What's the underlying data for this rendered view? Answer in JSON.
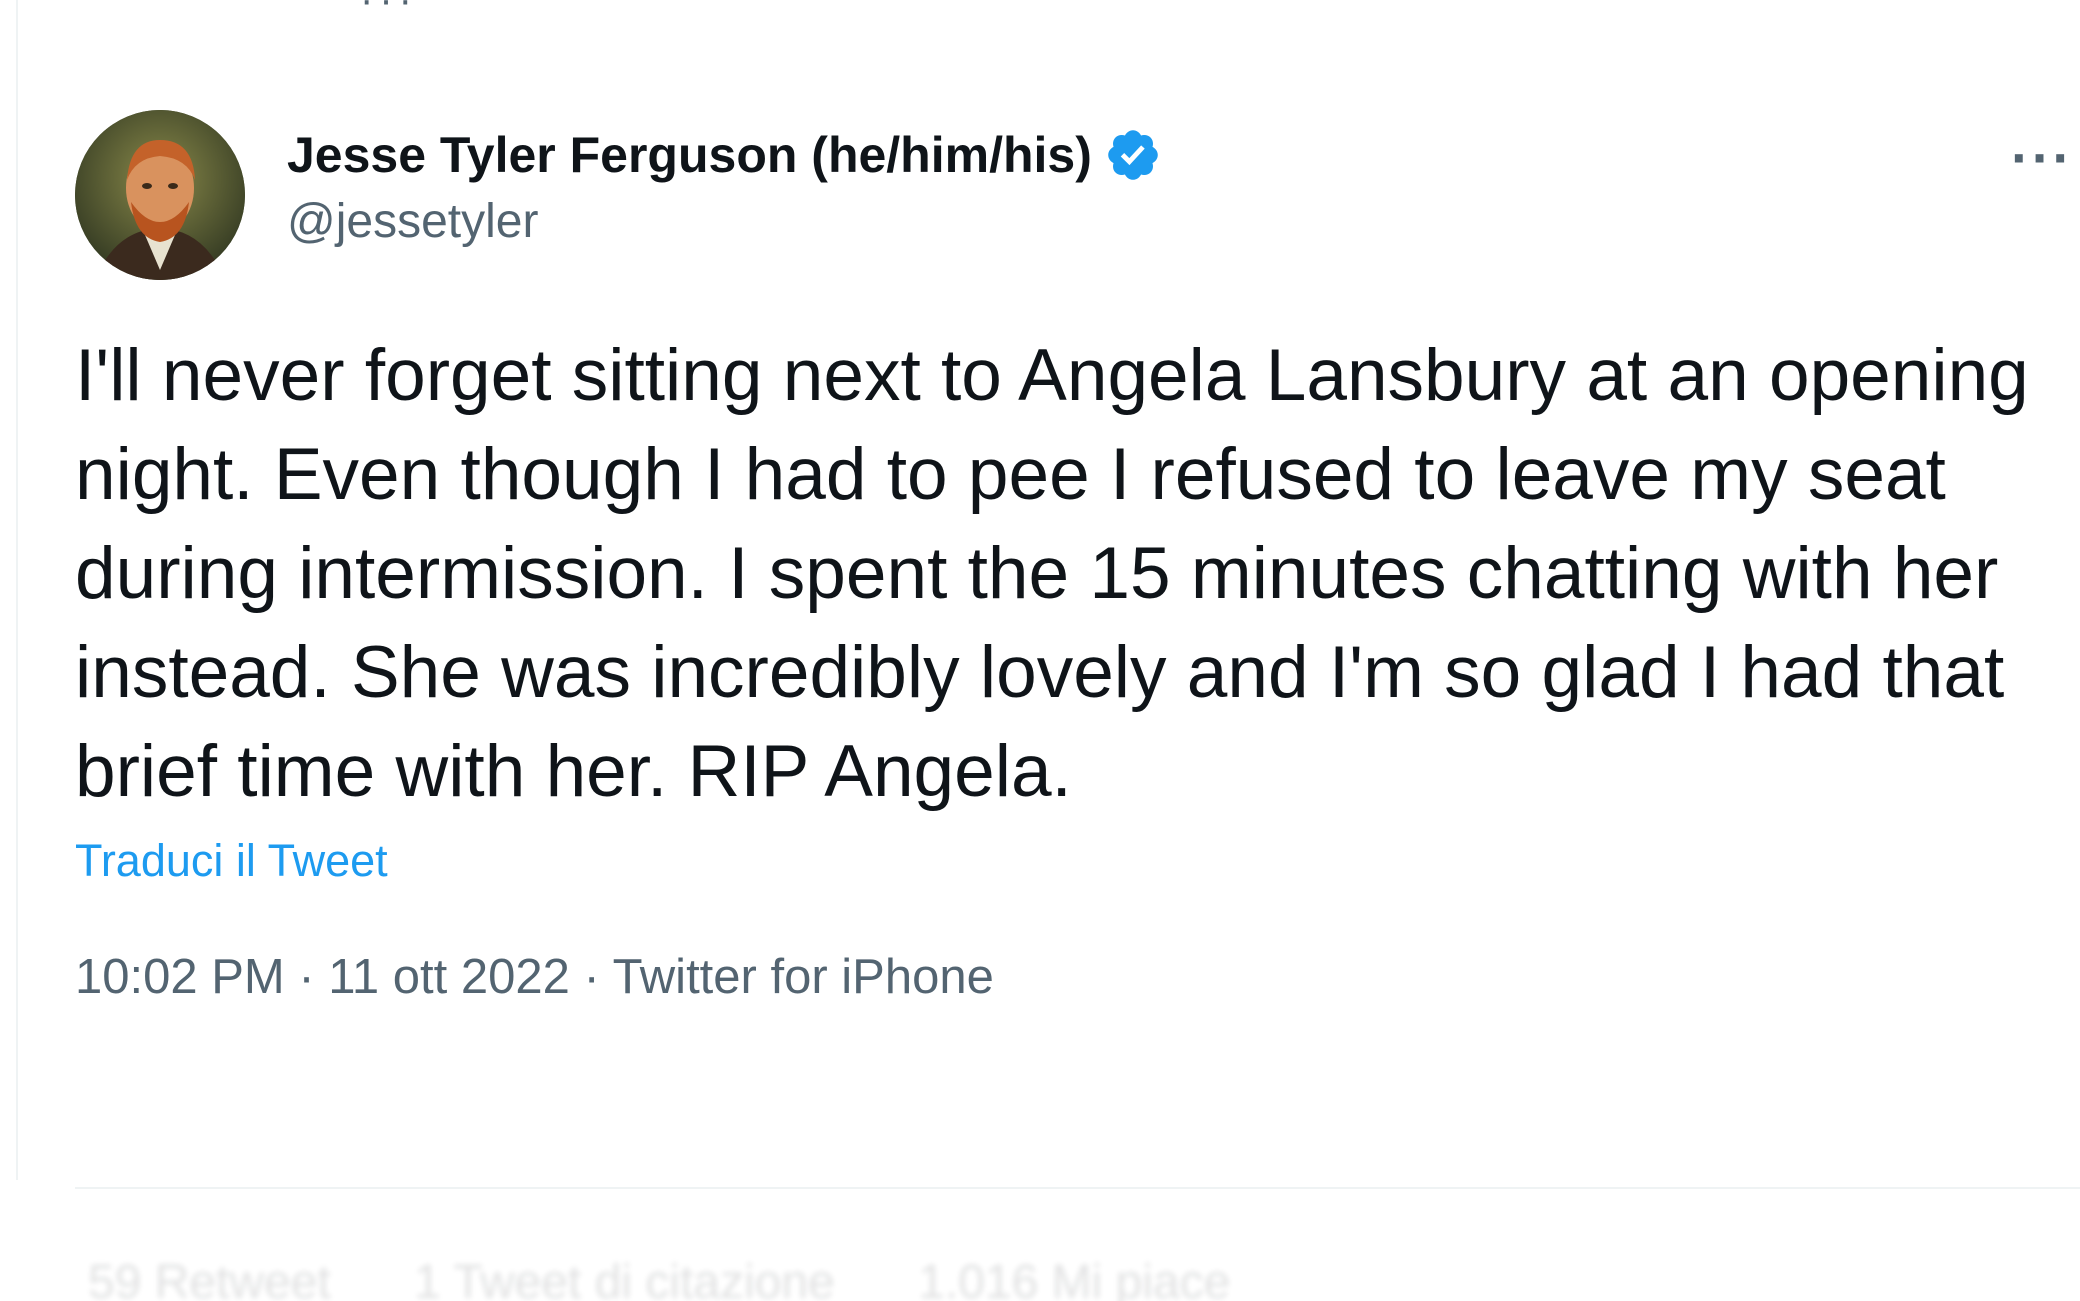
{
  "tweet": {
    "author_name": "Jesse Tyler Ferguson (he/him/his)",
    "handle": "@jessetyler",
    "text": "I'll never forget sitting next to Angela Lansbury at an opening night. Even though I had to pee I refused to leave my seat during intermission. I spent the 15 minutes chatting with her instead. She was incredibly lovely and I'm so glad I had that brief time with her. RIP Angela.",
    "translate_label": "Traduci il Tweet",
    "time": "10:02 PM",
    "date": "11 ott 2022",
    "source": "Twitter for iPhone",
    "more_icon": "ellipsis-icon",
    "verified_icon": "verified-badge-icon"
  },
  "stats": {
    "retweets": "59 Retweet",
    "quotes": "1 Tweet di citazione",
    "likes": "1.016 Mi piace"
  },
  "colors": {
    "text": "#0f1419",
    "secondary": "#536471",
    "link": "#1d9bf0",
    "verified": "#1d9bf0",
    "divider": "#eff3f4"
  }
}
